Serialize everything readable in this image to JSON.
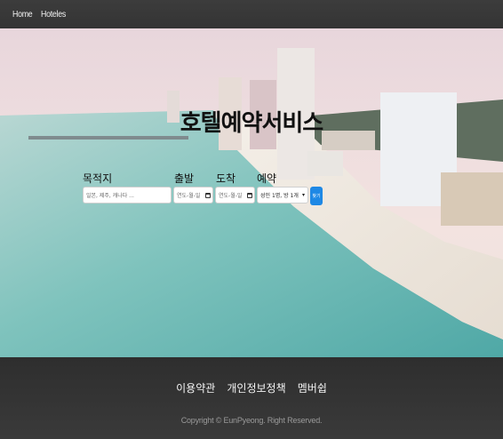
{
  "nav": {
    "links": [
      "Home",
      "Hoteles"
    ]
  },
  "hero": {
    "title": "호텔예약서비스",
    "labels": {
      "destination": "목적지",
      "checkin": "출발",
      "checkout": "도착",
      "guests": "예약"
    },
    "destination_placeholder": "일본, 제주, 캐나다 ...",
    "date_placeholder": "연도-월-일",
    "guests_value": "성인 1명, 방 1개",
    "search_label": "찾기"
  },
  "footer": {
    "links": [
      "이용약관",
      "개인정보정책",
      "멤버쉽"
    ],
    "copyright": "Copyright © EunPyeong. Right Reserved."
  },
  "colors": {
    "navbar": "#3a3a3a",
    "footer": "#333333",
    "accent": "#1e88e5"
  }
}
